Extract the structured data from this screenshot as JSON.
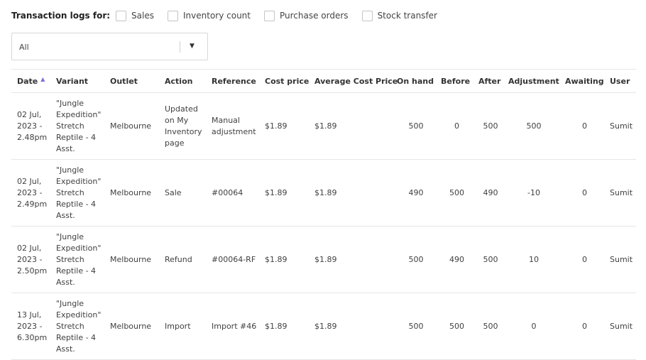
{
  "filters": {
    "title": "Transaction logs for:",
    "options": [
      {
        "label": "Sales",
        "checked": false
      },
      {
        "label": "Inventory count",
        "checked": false
      },
      {
        "label": "Purchase orders",
        "checked": false
      },
      {
        "label": "Stock transfer",
        "checked": false
      }
    ]
  },
  "outlet_select": {
    "value": "All",
    "icon": "chevron-down-icon"
  },
  "table": {
    "sort": {
      "column": "Date",
      "direction": "ascending",
      "icon": "sort-ascending-icon",
      "color": "#7b6fd6"
    },
    "columns": [
      "Date",
      "Variant",
      "Outlet",
      "Action",
      "Reference",
      "Cost price",
      "Average Cost Price",
      "On hand",
      "Before",
      "After",
      "Adjustment",
      "Awaiting",
      "User"
    ],
    "rows": [
      {
        "date": [
          "02 Jul,",
          "2023 -",
          "2.48pm"
        ],
        "variant": [
          "\"Jungle",
          "Expedition\"",
          "Stretch",
          "Reptile - 4",
          "Asst."
        ],
        "outlet": "Melbourne",
        "action": [
          "Updated",
          "on My",
          "Inventory",
          "page"
        ],
        "reference": [
          "Manual",
          "adjustment"
        ],
        "cost_price": "$1.89",
        "avg_cost_price": "$1.89",
        "on_hand": "500",
        "before": "0",
        "after": "500",
        "adjustment": "500",
        "awaiting": "0",
        "user": "Sumit"
      },
      {
        "date": [
          "02 Jul,",
          "2023 -",
          "2.49pm"
        ],
        "variant": [
          "\"Jungle",
          "Expedition\"",
          "Stretch",
          "Reptile - 4",
          "Asst."
        ],
        "outlet": "Melbourne",
        "action": [
          "Sale"
        ],
        "reference": [
          "#00064"
        ],
        "cost_price": "$1.89",
        "avg_cost_price": "$1.89",
        "on_hand": "490",
        "before": "500",
        "after": "490",
        "adjustment": "-10",
        "awaiting": "0",
        "user": "Sumit"
      },
      {
        "date": [
          "02 Jul,",
          "2023 -",
          "2.50pm"
        ],
        "variant": [
          "\"Jungle",
          "Expedition\"",
          "Stretch",
          "Reptile - 4",
          "Asst."
        ],
        "outlet": "Melbourne",
        "action": [
          "Refund"
        ],
        "reference": [
          "#00064-RF"
        ],
        "cost_price": "$1.89",
        "avg_cost_price": "$1.89",
        "on_hand": "500",
        "before": "490",
        "after": "500",
        "adjustment": "10",
        "awaiting": "0",
        "user": "Sumit"
      },
      {
        "date": [
          "13 Jul,",
          "2023 -",
          "6.30pm"
        ],
        "variant": [
          "\"Jungle",
          "Expedition\"",
          "Stretch",
          "Reptile - 4",
          "Asst."
        ],
        "outlet": "Melbourne",
        "action": [
          "Import"
        ],
        "reference": [
          "Import #46"
        ],
        "cost_price": "$1.89",
        "avg_cost_price": "$1.89",
        "on_hand": "500",
        "before": "500",
        "after": "500",
        "adjustment": "0",
        "awaiting": "0",
        "user": "Sumit"
      }
    ]
  }
}
